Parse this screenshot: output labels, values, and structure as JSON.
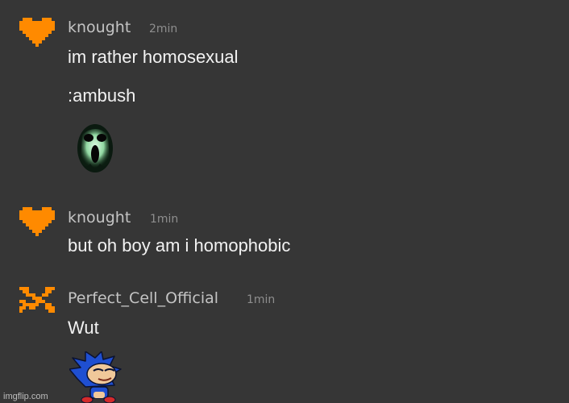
{
  "colors": {
    "background": "#363636",
    "username": "#c4c4c4",
    "timestamp": "#8e8e8e",
    "message_text": "#f2f2f2",
    "heart_orange": "#ff8a00"
  },
  "messages": [
    {
      "avatar_icon": "pixel-heart-icon",
      "username": "knought",
      "time": "2min",
      "lines": [
        "im rather homosexual",
        ":ambush"
      ],
      "attachment_icon": "ambush-ghost-emoji-icon"
    },
    {
      "avatar_icon": "pixel-heart-icon",
      "username": "knought",
      "time": "1min",
      "lines": [
        "but oh boy am i homophobic"
      ]
    },
    {
      "avatar_icon": "broken-pixel-heart-icon",
      "username": "Perfect_Cell_Official",
      "time": "1min",
      "lines": [
        "Wut"
      ],
      "attachment_icon": "sonic-sticker-icon"
    }
  ],
  "watermark": "imgflip.com"
}
